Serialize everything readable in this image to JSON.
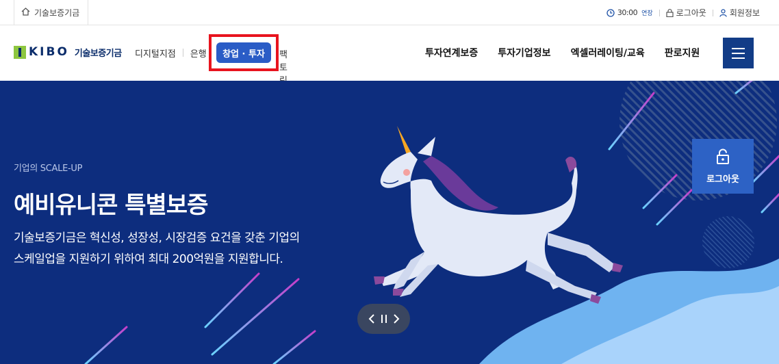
{
  "topbar": {
    "home_label": "기술보증기금",
    "timer": "30:00",
    "extend_label": "연장",
    "logout_label": "로그아웃",
    "member_label": "회원정보"
  },
  "header": {
    "logo_text": "KIBO",
    "logo_name": "기술보증기금",
    "subnav": [
      "디지털지점",
      "은행",
      "창업 · 투자",
      "팩토링"
    ],
    "gnb": [
      "투자연계보증",
      "투자기업정보",
      "엑셀러레이팅/교육",
      "판로지원"
    ]
  },
  "hero": {
    "eyebrow": "기업의 SCALE-UP",
    "headline": "예비유니콘 특별보증",
    "desc_line1": "기술보증기금은 혁신성, 성장성, 시장검증 요건을 갖춘 기업의",
    "desc_line2": "스케일업을 지원하기 위하여 최대 200억원을 지원합니다.",
    "logout_box_label": "로그아웃",
    "controls": {
      "prev": "‹",
      "pause": "II",
      "next": "›"
    }
  },
  "colors": {
    "brand_navy": "#123c87",
    "hero_bg": "#0d2d7e",
    "active_tab": "#2a5cc6",
    "highlight_red": "#e8141e"
  }
}
